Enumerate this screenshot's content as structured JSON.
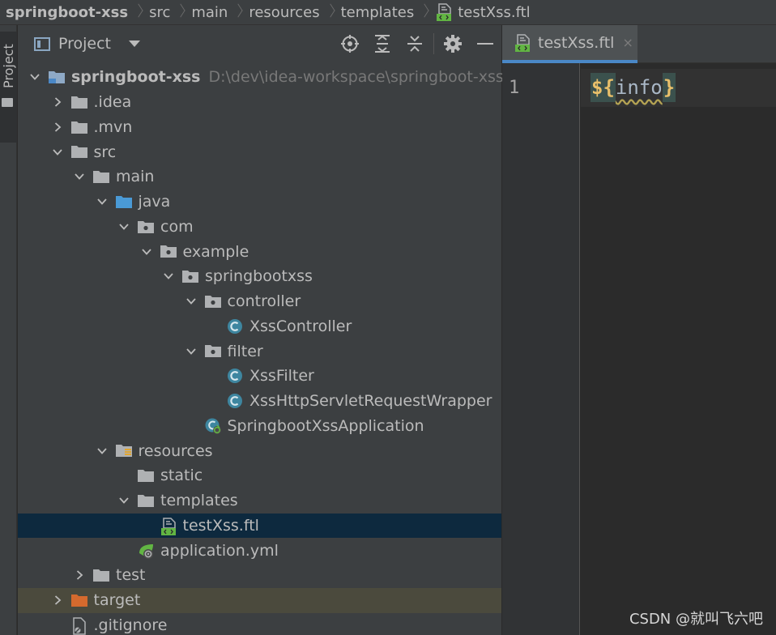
{
  "breadcrumb": [
    {
      "label": "springboot-xss"
    },
    {
      "label": "src"
    },
    {
      "label": "main"
    },
    {
      "label": "resources"
    },
    {
      "label": "templates"
    },
    {
      "label": "testXss.ftl",
      "icon": "ftl-file-icon"
    }
  ],
  "toolstrip": {
    "label": "Project"
  },
  "panel": {
    "title": "Project",
    "tools": [
      "locate-icon",
      "expand-all-icon",
      "collapse-all-icon",
      "gear-icon",
      "minimize-icon"
    ]
  },
  "tree": [
    {
      "label": "springboot-xss",
      "hint": "D:\\dev\\idea-workspace\\springboot-xss",
      "bold": true,
      "level": 0,
      "arrow": "down",
      "icon": "module"
    },
    {
      "label": ".idea",
      "level": 1,
      "arrow": "right",
      "icon": "folder"
    },
    {
      "label": ".mvn",
      "level": 1,
      "arrow": "right",
      "icon": "folder"
    },
    {
      "label": "src",
      "level": 1,
      "arrow": "down",
      "icon": "folder"
    },
    {
      "label": "main",
      "level": 2,
      "arrow": "down",
      "icon": "folder"
    },
    {
      "label": "java",
      "level": 3,
      "arrow": "down",
      "icon": "source-folder"
    },
    {
      "label": "com",
      "level": 4,
      "arrow": "down",
      "icon": "package"
    },
    {
      "label": "example",
      "level": 5,
      "arrow": "down",
      "icon": "package"
    },
    {
      "label": "springbootxss",
      "level": 6,
      "arrow": "down",
      "icon": "package"
    },
    {
      "label": "controller",
      "level": 7,
      "arrow": "down",
      "icon": "package"
    },
    {
      "label": "XssController",
      "level": 8,
      "arrow": "none",
      "icon": "class"
    },
    {
      "label": "filter",
      "level": 7,
      "arrow": "down",
      "icon": "package"
    },
    {
      "label": "XssFilter",
      "level": 8,
      "arrow": "none",
      "icon": "class"
    },
    {
      "label": "XssHttpServletRequestWrapper",
      "level": 8,
      "arrow": "none",
      "icon": "class"
    },
    {
      "label": "SpringbootXssApplication",
      "level": 7,
      "arrow": "none",
      "icon": "spring-class"
    },
    {
      "label": "resources",
      "level": 3,
      "arrow": "down",
      "icon": "resources-folder"
    },
    {
      "label": "static",
      "level": 4,
      "arrow": "none",
      "icon": "folder"
    },
    {
      "label": "templates",
      "level": 4,
      "arrow": "down",
      "icon": "folder"
    },
    {
      "label": "testXss.ftl",
      "level": 5,
      "arrow": "none",
      "icon": "ftl-file",
      "selected": true
    },
    {
      "label": "application.yml",
      "level": 4,
      "arrow": "none",
      "icon": "yml-file"
    },
    {
      "label": "test",
      "level": 2,
      "arrow": "right",
      "icon": "folder"
    },
    {
      "label": "target",
      "level": 1,
      "arrow": "right",
      "icon": "excluded-folder",
      "excluded": true
    },
    {
      "label": ".gitignore",
      "level": 1,
      "arrow": "none",
      "icon": "gitignore-file"
    }
  ],
  "editor": {
    "tab_label": "testXss.ftl",
    "tab_close": "×",
    "line_number": "1",
    "code": {
      "open": "${",
      "var": "info",
      "close": "}"
    }
  },
  "watermark": "CSDN @就叫飞六吧",
  "colors": {
    "selection": "#0d293e",
    "tab_underline": "#4a88c7",
    "class_icon": "#3e86a0",
    "folder": "#afb1b3",
    "source_folder": "#4a9ad6",
    "excluded_folder": "#d56a2e",
    "ftl_green": "#62b543"
  }
}
